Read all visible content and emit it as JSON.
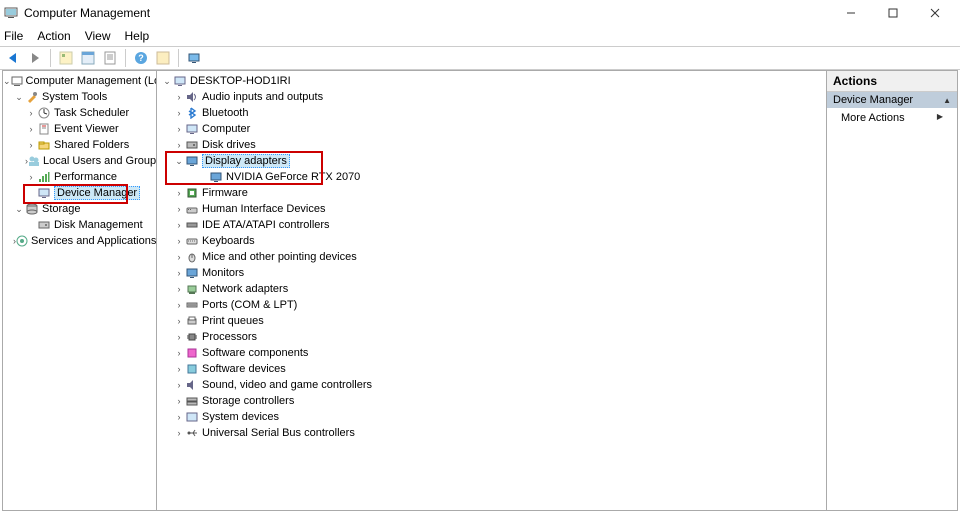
{
  "title": "Computer Management",
  "menus": [
    "File",
    "Action",
    "View",
    "Help"
  ],
  "leftTree": {
    "root": "Computer Management (Local)",
    "groups": [
      {
        "label": "System Tools",
        "expanded": true,
        "items": [
          "Task Scheduler",
          "Event Viewer",
          "Shared Folders",
          "Local Users and Groups",
          "Performance",
          "Device Manager"
        ],
        "selectedIndex": 5
      },
      {
        "label": "Storage",
        "expanded": true,
        "items": [
          "Disk Management"
        ]
      },
      {
        "label": "Services and Applications",
        "expanded": false,
        "items": []
      }
    ]
  },
  "midTree": {
    "root": "DESKTOP-HOD1IRI",
    "categories": [
      {
        "label": "Audio inputs and outputs",
        "expanded": false
      },
      {
        "label": "Bluetooth",
        "expanded": false
      },
      {
        "label": "Computer",
        "expanded": false
      },
      {
        "label": "Disk drives",
        "expanded": false
      },
      {
        "label": "Display adapters",
        "expanded": true,
        "highlighted": true,
        "children": [
          "NVIDIA GeForce RTX 2070"
        ]
      },
      {
        "label": "Firmware",
        "expanded": false
      },
      {
        "label": "Human Interface Devices",
        "expanded": false
      },
      {
        "label": "IDE ATA/ATAPI controllers",
        "expanded": false
      },
      {
        "label": "Keyboards",
        "expanded": false
      },
      {
        "label": "Mice and other pointing devices",
        "expanded": false
      },
      {
        "label": "Monitors",
        "expanded": false
      },
      {
        "label": "Network adapters",
        "expanded": false
      },
      {
        "label": "Ports (COM & LPT)",
        "expanded": false
      },
      {
        "label": "Print queues",
        "expanded": false
      },
      {
        "label": "Processors",
        "expanded": false
      },
      {
        "label": "Software components",
        "expanded": false
      },
      {
        "label": "Software devices",
        "expanded": false
      },
      {
        "label": "Sound, video and game controllers",
        "expanded": false
      },
      {
        "label": "Storage controllers",
        "expanded": false
      },
      {
        "label": "System devices",
        "expanded": false
      },
      {
        "label": "Universal Serial Bus controllers",
        "expanded": false
      }
    ]
  },
  "actions": {
    "header": "Actions",
    "group": "Device Manager",
    "items": [
      "More Actions"
    ]
  }
}
